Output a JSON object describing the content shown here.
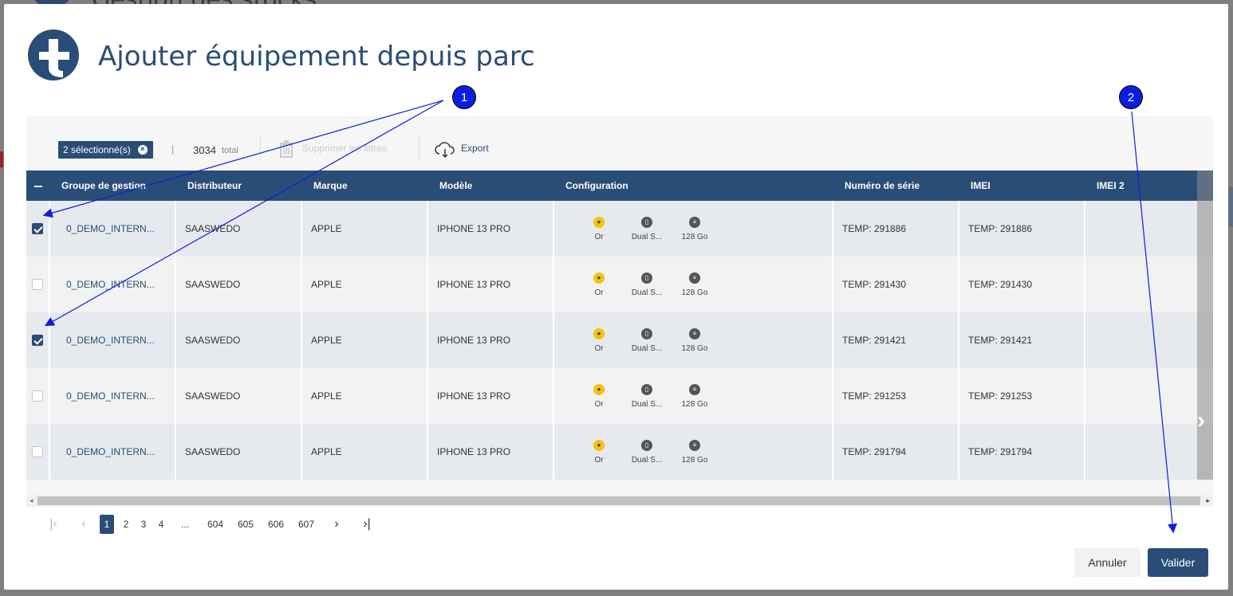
{
  "background": {
    "title": "Gestion des stocks"
  },
  "modal": {
    "title": "Ajouter équipement depuis parc"
  },
  "toolbar": {
    "selected_label": "2 sélectionné(s)",
    "separator": "|",
    "total_count": "3034",
    "total_label": "total",
    "clear_filters_label": "Supprimer les filtres",
    "export_label": "Export"
  },
  "grid": {
    "columns": [
      "Groupe de gestion",
      "Distributeur",
      "Marque",
      "Modèle",
      "Configuration",
      "Numéro de série",
      "IMEI",
      "IMEI 2"
    ],
    "rows": [
      {
        "checked": true,
        "group": "0_DEMO_INTERN...",
        "distributor": "SAASWEDO",
        "brand": "APPLE",
        "model": "IPHONE 13 PRO",
        "cfg_color": "Or",
        "cfg_sim": "Dual S...",
        "cfg_storage": "128 Go",
        "serial": "TEMP: 291886",
        "imei": "TEMP: 291886",
        "imei2": ""
      },
      {
        "checked": false,
        "group": "0_DEMO_INTERN...",
        "distributor": "SAASWEDO",
        "brand": "APPLE",
        "model": "IPHONE 13 PRO",
        "cfg_color": "Or",
        "cfg_sim": "Dual S...",
        "cfg_storage": "128 Go",
        "serial": "TEMP: 291430",
        "imei": "TEMP: 291430",
        "imei2": ""
      },
      {
        "checked": true,
        "group": "0_DEMO_INTERN...",
        "distributor": "SAASWEDO",
        "brand": "APPLE",
        "model": "IPHONE 13 PRO",
        "cfg_color": "Or",
        "cfg_sim": "Dual S...",
        "cfg_storage": "128 Go",
        "serial": "TEMP: 291421",
        "imei": "TEMP: 291421",
        "imei2": ""
      },
      {
        "checked": false,
        "group": "0_DEMO_INTERN...",
        "distributor": "SAASWEDO",
        "brand": "APPLE",
        "model": "IPHONE 13 PRO",
        "cfg_color": "Or",
        "cfg_sim": "Dual S...",
        "cfg_storage": "128 Go",
        "serial": "TEMP: 291253",
        "imei": "TEMP: 291253",
        "imei2": ""
      },
      {
        "checked": false,
        "group": "0_DEMO_INTERN...",
        "distributor": "SAASWEDO",
        "brand": "APPLE",
        "model": "IPHONE 13 PRO",
        "cfg_color": "Or",
        "cfg_sim": "Dual S...",
        "cfg_storage": "128 Go",
        "serial": "TEMP: 291794",
        "imei": "TEMP: 291794",
        "imei2": ""
      }
    ]
  },
  "pagination": {
    "pages": [
      "1",
      "2",
      "3",
      "4",
      "...",
      "604",
      "605",
      "606",
      "607"
    ],
    "current": "1"
  },
  "footer": {
    "cancel_label": "Annuler",
    "validate_label": "Valider"
  },
  "annotations": {
    "badge1": "1",
    "badge2": "2"
  },
  "colors": {
    "primary": "#2a4d77",
    "annotation": "#0b1ee0",
    "config_yellow": "#f5c400"
  },
  "icons": {
    "color": "palette-icon",
    "sim": "sim-card-icon",
    "storage": "database-icon",
    "export": "cloud-download-icon",
    "clear": "trash-icon"
  }
}
